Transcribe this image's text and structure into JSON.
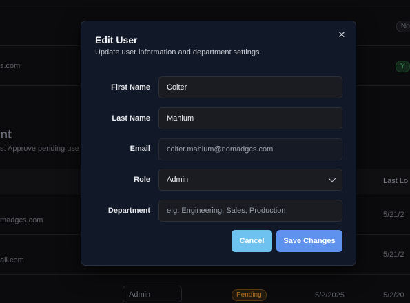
{
  "background": {
    "email_partial_1": "s.com",
    "section_heading_partial": "nt",
    "section_desc_partial": "s. Approve pending use",
    "column_last_login_partial": "Last Lo",
    "row1_email_partial": "madgcs.com",
    "row1_date_partial": "5/21/2",
    "row2_email_partial": "ail.com",
    "row2_date_partial": "5/21/2",
    "row3_role": "Admin",
    "row3_status": "Pending",
    "row3_date1": "5/2/2025",
    "row3_date2": "5/2/20",
    "pill_top_partial": "No",
    "pill_green_partial": "Y"
  },
  "modal": {
    "title": "Edit User",
    "description": "Update user information and department settings.",
    "close_symbol": "✕",
    "fields": {
      "first_name": {
        "label": "First Name",
        "value": "Colter"
      },
      "last_name": {
        "label": "Last Name",
        "value": "Mahlum"
      },
      "email": {
        "label": "Email",
        "value": "colter.mahlum@nomadgcs.com"
      },
      "role": {
        "label": "Role",
        "value": "Admin"
      },
      "department": {
        "label": "Department",
        "value": "",
        "placeholder": "e.g. Engineering, Sales, Production"
      }
    },
    "cancel_label": "Cancel",
    "save_label": "Save Changes"
  },
  "colors": {
    "modal_bg": "#111827",
    "cancel_button": "#6dc2ef",
    "save_button": "#5e92ee",
    "pending_badge": "#b06d1e"
  },
  "icons": [
    "close-icon",
    "chevron-down-icon"
  ]
}
